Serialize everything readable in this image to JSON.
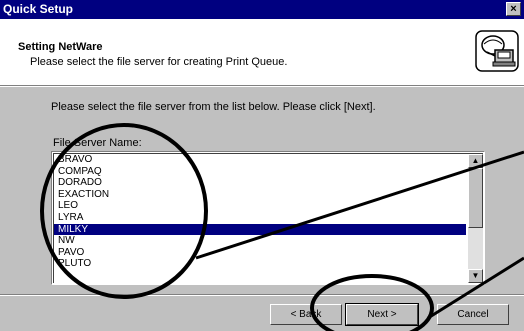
{
  "window": {
    "title": "Quick Setup",
    "close_glyph": "×"
  },
  "header": {
    "title": "Setting NetWare",
    "subtitle": "Please select the file server for creating Print Queue.",
    "icon": "printer-network-icon"
  },
  "main": {
    "instruction": "Please select the file server from the list below. Please click [Next].",
    "list_label": "File Server Name:",
    "servers": [
      "BRAVO",
      "COMPAQ",
      "DORADO",
      "EXACTION",
      "LEO",
      "LYRA",
      "MILKY",
      "NW",
      "PAVO",
      "PLUTO"
    ],
    "selected": "MILKY"
  },
  "buttons": {
    "back": "< Back",
    "next": "Next >",
    "cancel": "Cancel"
  },
  "colors": {
    "titlebar": "#000080",
    "selection": "#000080",
    "face": "#c0c0c0"
  }
}
